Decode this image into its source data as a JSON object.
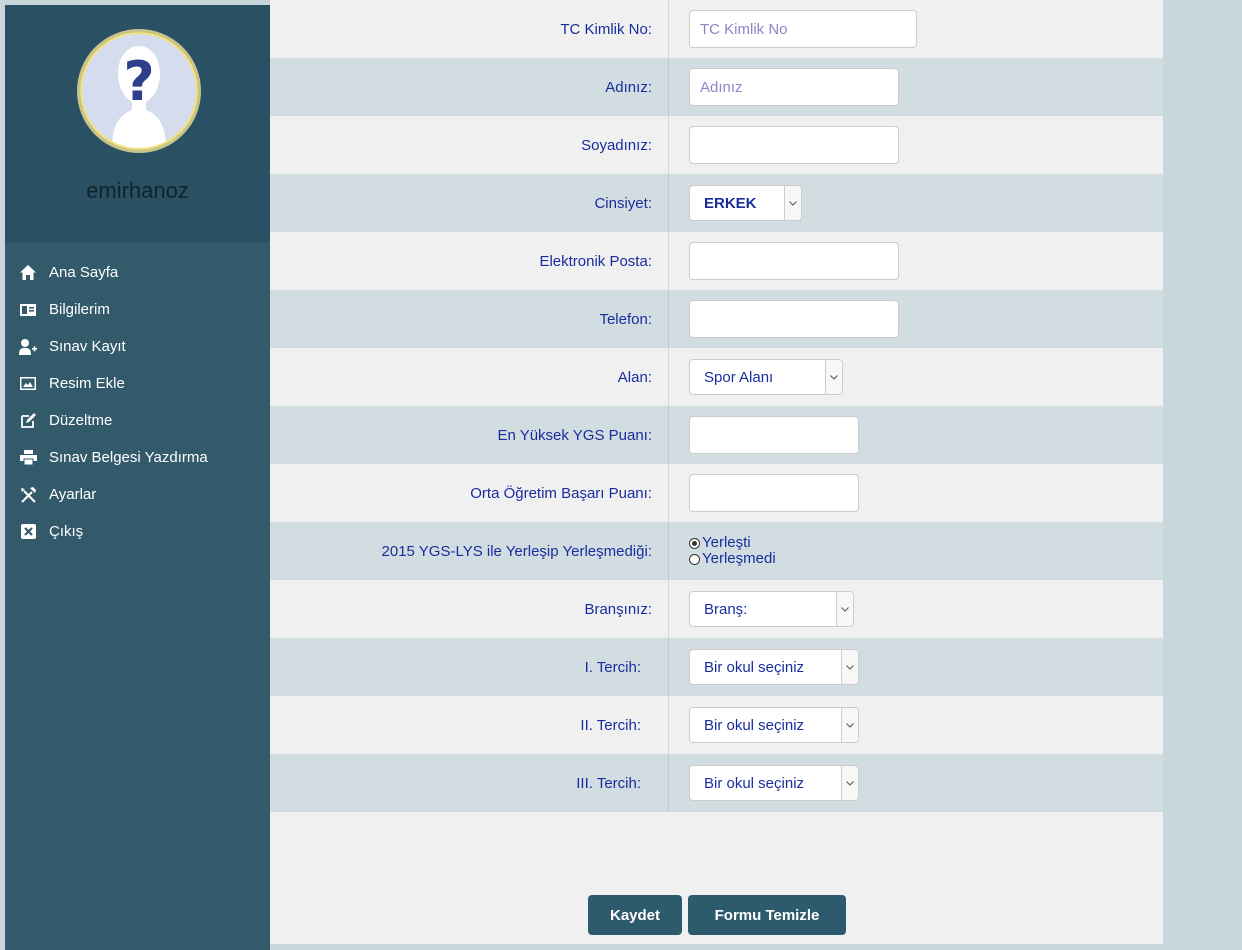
{
  "user": {
    "name": "emirhanoz"
  },
  "menu": [
    {
      "label": "Ana Sayfa",
      "icon": "home-icon"
    },
    {
      "label": "Bilgilerim",
      "icon": "id-card-icon"
    },
    {
      "label": "Sınav Kayıt",
      "icon": "add-user-icon"
    },
    {
      "label": "Resim Ekle",
      "icon": "picture-icon"
    },
    {
      "label": "Düzeltme",
      "icon": "edit-icon"
    },
    {
      "label": "Sınav Belgesi Yazdırma",
      "icon": "printer-icon"
    },
    {
      "label": "Ayarlar",
      "icon": "tools-icon"
    },
    {
      "label": "Çıkış",
      "icon": "close-box-icon"
    }
  ],
  "form": {
    "tc": {
      "label": "TC Kimlik No:",
      "placeholder": "TC Kimlik No",
      "value": ""
    },
    "ad": {
      "label": "Adınız:",
      "placeholder": "Adınız",
      "value": ""
    },
    "soyad": {
      "label": "Soyadınız:",
      "value": ""
    },
    "cinsiyet": {
      "label": "Cinsiyet:",
      "selected": "ERKEK"
    },
    "eposta": {
      "label": "Elektronik Posta:",
      "value": ""
    },
    "telefon": {
      "label": "Telefon:",
      "value": ""
    },
    "alan": {
      "label": "Alan:",
      "selected": "Spor Alanı"
    },
    "ygs": {
      "label": "En Yüksek YGS Puanı:",
      "value": ""
    },
    "obp": {
      "label": "Orta Öğretim Başarı Puanı:",
      "value": ""
    },
    "yerlesme": {
      "label": "2015 YGS-LYS ile Yerleşip Yerleşmediği:",
      "options": [
        "Yerleşti",
        "Yerleşmedi"
      ],
      "selected": "Yerleşti"
    },
    "brans": {
      "label": "Branşınız:",
      "selected": "Branş:"
    },
    "tercih1": {
      "label": "I. Tercih:",
      "selected": "Bir okul seçiniz"
    },
    "tercih2": {
      "label": "II. Tercih:",
      "selected": "Bir okul seçiniz"
    },
    "tercih3": {
      "label": "III. Tercih:",
      "selected": "Bir okul seçiniz"
    }
  },
  "buttons": {
    "save": "Kaydet",
    "clear": "Formu Temizle"
  }
}
